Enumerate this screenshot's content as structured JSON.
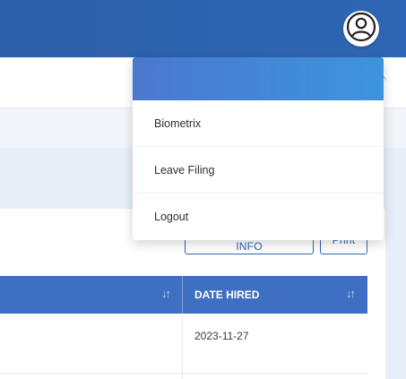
{
  "header": {
    "avatar_icon": "user-circle-icon"
  },
  "user_menu": {
    "items": [
      {
        "label": "Biometrix"
      },
      {
        "label": "Leave Filing"
      },
      {
        "label": "Logout"
      }
    ]
  },
  "toolbar": {
    "add_employee_label": "ADD EMPLOYEE INFO",
    "print_label": "Print"
  },
  "table": {
    "columns": [
      {
        "label": "",
        "sort_icon": "sort-arrows-icon"
      },
      {
        "label": "DATE HIRED",
        "sort_icon": "sort-arrows-icon"
      }
    ],
    "rows": [
      {
        "date_hired": "2023-11-27"
      }
    ]
  },
  "colors": {
    "topbar": "#2f66b5",
    "table_header": "#3e6fc3",
    "accent": "#2f66b5"
  }
}
